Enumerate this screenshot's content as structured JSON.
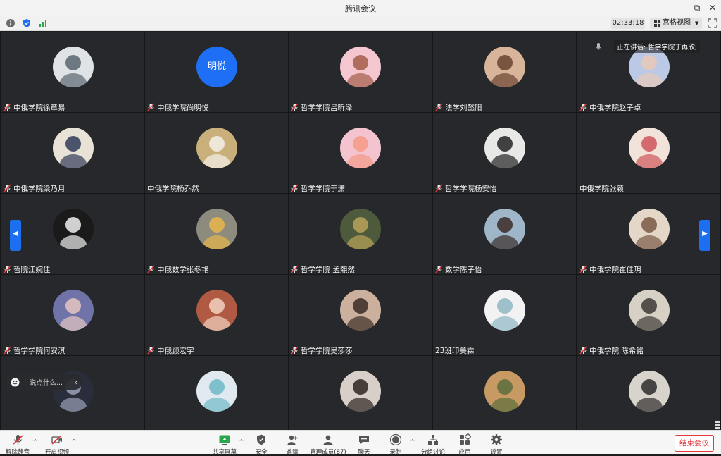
{
  "window": {
    "title": "腾讯会议"
  },
  "toolbar": {
    "timer": "02:33:18",
    "view_label": "宫格视图"
  },
  "speaking": {
    "text": "正在讲话: 哲学学院丁再欣;"
  },
  "chat": {
    "placeholder": "说点什么..."
  },
  "participants": [
    {
      "name": "中俄学院徐章易",
      "muted": true,
      "avatar": {
        "kind": "photo",
        "bg": "#dfe3e6",
        "fg": "#5b6570"
      }
    },
    {
      "name": "中俄学院尚明悦",
      "muted": true,
      "avatar": {
        "kind": "text",
        "text": "明悦",
        "bg": "#1e6ff5"
      }
    },
    {
      "name": "哲学学院吕昕泽",
      "muted": true,
      "avatar": {
        "kind": "photo",
        "bg": "#f4c6cf",
        "fg": "#a35d4a"
      }
    },
    {
      "name": "法学刘懿阳",
      "muted": true,
      "avatar": {
        "kind": "photo",
        "bg": "#d8b59a",
        "fg": "#6b4330"
      }
    },
    {
      "name": "中俄学院赵子卓",
      "muted": true,
      "avatar": {
        "kind": "photo",
        "bg": "#bcc9e6",
        "fg": "#e8c9b8"
      }
    },
    {
      "name": "中俄学院梁乃月",
      "muted": true,
      "avatar": {
        "kind": "photo",
        "bg": "#e9e2d6",
        "fg": "#2f3b58"
      }
    },
    {
      "name": "中俄学院杨乔然",
      "muted": false,
      "avatar": {
        "kind": "photo",
        "bg": "#c9b07a",
        "fg": "#f4f1ea"
      }
    },
    {
      "name": "哲学学院于潇",
      "muted": true,
      "avatar": {
        "kind": "photo",
        "bg": "#f3c4cf",
        "fg": "#f59a86"
      }
    },
    {
      "name": "哲学学院杨安怡",
      "muted": true,
      "avatar": {
        "kind": "photo",
        "bg": "#e8e8e6",
        "fg": "#222222"
      }
    },
    {
      "name": "中俄学院张颖",
      "muted": false,
      "avatar": {
        "kind": "photo",
        "bg": "#f1e3d9",
        "fg": "#d0555b"
      }
    },
    {
      "name": "哲院江婉佳",
      "muted": true,
      "avatar": {
        "kind": "photo",
        "bg": "#1a1a1a",
        "fg": "#f1f1f1"
      }
    },
    {
      "name": "中俄数学张冬艳",
      "muted": true,
      "avatar": {
        "kind": "photo",
        "bg": "#8d8a7e",
        "fg": "#e7b64a"
      }
    },
    {
      "name": "哲学学院 孟熙然",
      "muted": true,
      "avatar": {
        "kind": "photo",
        "bg": "#4d5a3b",
        "fg": "#b9a25a"
      }
    },
    {
      "name": "数学陈子怡",
      "muted": true,
      "avatar": {
        "kind": "photo",
        "bg": "#9fb6c8",
        "fg": "#3b2c28"
      }
    },
    {
      "name": "中俄学院崔佳玥",
      "muted": true,
      "avatar": {
        "kind": "photo",
        "bg": "#e4d7c8",
        "fg": "#7a5b45"
      }
    },
    {
      "name": "哲学学院何安淇",
      "muted": true,
      "avatar": {
        "kind": "photo",
        "bg": "#6f73a8",
        "fg": "#e6c7c2"
      }
    },
    {
      "name": "中俄顾宏宇",
      "muted": true,
      "avatar": {
        "kind": "photo",
        "bg": "#b05a44",
        "fg": "#f1d3c1"
      }
    },
    {
      "name": "哲学学院吴莎莎",
      "muted": true,
      "avatar": {
        "kind": "photo",
        "bg": "#cbb19d",
        "fg": "#3a2c24"
      }
    },
    {
      "name": "23班印美霖",
      "muted": false,
      "avatar": {
        "kind": "photo",
        "bg": "#f2f2f2",
        "fg": "#8fb7c4"
      }
    },
    {
      "name": "中俄学院 陈希铭",
      "muted": true,
      "avatar": {
        "kind": "photo",
        "bg": "#d7d0c4",
        "fg": "#3e3a36"
      }
    },
    {
      "name": "",
      "muted": false,
      "avatar": {
        "kind": "photo",
        "bg": "#2a2d3a",
        "fg": "#9aa1b8"
      }
    },
    {
      "name": "",
      "muted": false,
      "avatar": {
        "kind": "photo",
        "bg": "#dfe9ef",
        "fg": "#6fb9c8"
      }
    },
    {
      "name": "",
      "muted": false,
      "avatar": {
        "kind": "photo",
        "bg": "#d9cfc9",
        "fg": "#2c2420"
      }
    },
    {
      "name": "",
      "muted": false,
      "avatar": {
        "kind": "photo",
        "bg": "#c89a63",
        "fg": "#5a6d3d"
      }
    },
    {
      "name": "",
      "muted": false,
      "avatar": {
        "kind": "photo",
        "bg": "#d9d4cb",
        "fg": "#2d2c2b"
      }
    }
  ],
  "controls": {
    "unmute": "解除静音",
    "start_video": "开启视频",
    "share_screen": "共享屏幕",
    "security": "安全",
    "invite": "邀请",
    "manage_members": "管理成员(87)",
    "chat": "聊天",
    "record": "录制",
    "breakout": "分组讨论",
    "apps": "应用",
    "settings": "设置",
    "end_meeting": "结束会议"
  },
  "colors": {
    "accent": "#1e6ff5",
    "end": "#e13b3b",
    "tile": "#26282b",
    "grid_bg": "#141517"
  }
}
